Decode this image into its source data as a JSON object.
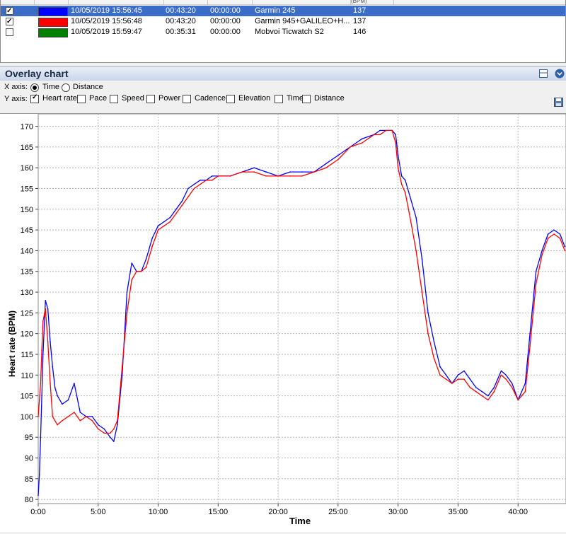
{
  "sessions": {
    "header_partial": "(BPM)",
    "rows": [
      {
        "checked": true,
        "selected": true,
        "color": "#0000ff",
        "start": "10/05/2019 15:56:45",
        "duration": "00:43:20",
        "offset": "00:00:00",
        "device": "Garmin 245",
        "hr": "137"
      },
      {
        "checked": true,
        "selected": false,
        "color": "#ff0000",
        "start": "10/05/2019 15:56:48",
        "duration": "00:43:20",
        "offset": "00:00:00",
        "device": "Garmin  945+GALILEO+H...",
        "hr": "137"
      },
      {
        "checked": false,
        "selected": false,
        "color": "#008000",
        "start": "10/05/2019 15:59:47",
        "duration": "00:35:31",
        "offset": "00:00:00",
        "device": "Mobvoi Ticwatch S2",
        "hr": "146"
      }
    ]
  },
  "panel": {
    "title": "Overlay chart",
    "xaxis_label": "X axis:",
    "xaxis_options": [
      {
        "label": "Time",
        "selected": true
      },
      {
        "label": "Distance",
        "selected": false
      }
    ],
    "yaxis_label": "Y axis:",
    "yaxis_options": [
      {
        "label": "Heart rate",
        "checked": true
      },
      {
        "label": "Pace",
        "checked": false
      },
      {
        "label": "Speed",
        "checked": false
      },
      {
        "label": "Power",
        "checked": false
      },
      {
        "label": "Cadence",
        "checked": false
      },
      {
        "label": "Elevation",
        "checked": false
      },
      {
        "label": "Time",
        "checked": false
      },
      {
        "label": "Distance",
        "checked": false
      }
    ]
  },
  "chart_data": {
    "type": "line",
    "xlabel": "Time",
    "ylabel": "Heart rate (BPM)",
    "xlim": [
      0,
      44
    ],
    "ylim": [
      79,
      173
    ],
    "x_ticks": [
      0,
      5,
      10,
      15,
      20,
      25,
      30,
      35,
      40
    ],
    "x_tick_labels": [
      "0:00",
      "5:00",
      "10:00",
      "15:00",
      "20:00",
      "25:00",
      "30:00",
      "35:00",
      "40:00"
    ],
    "y_ticks": [
      80,
      85,
      90,
      95,
      100,
      105,
      110,
      115,
      120,
      125,
      130,
      135,
      140,
      145,
      150,
      155,
      160,
      165,
      170
    ],
    "grid": true,
    "series": [
      {
        "color": "#0000ff",
        "x": [
          0,
          0.1,
          0.2,
          0.3,
          0.4,
          0.6,
          0.8,
          1.0,
          1.2,
          1.4,
          1.6,
          2.0,
          2.5,
          3.0,
          3.5,
          4.0,
          4.5,
          5.0,
          5.5,
          6.0,
          6.3,
          6.6,
          7.0,
          7.4,
          7.8,
          8.2,
          8.6,
          9.0,
          9.5,
          10.0,
          10.5,
          11.0,
          11.5,
          12.0,
          12.5,
          13.0,
          13.5,
          14.0,
          14.5,
          15.0,
          16.0,
          17.0,
          18.0,
          19.0,
          20.0,
          21.0,
          22.0,
          23.0,
          24.0,
          25.0,
          26.0,
          27.0,
          28.0,
          28.5,
          29.0,
          29.5,
          29.8,
          30.0,
          30.3,
          30.6,
          31.0,
          31.5,
          32.0,
          32.5,
          33.0,
          33.5,
          34.0,
          34.5,
          35.0,
          35.5,
          36.0,
          36.5,
          37.0,
          37.5,
          38.0,
          38.3,
          38.6,
          39.0,
          39.5,
          40.0,
          40.3,
          40.6,
          41.0,
          41.5,
          42.0,
          42.5,
          43.0,
          43.5,
          43.9
        ],
        "y": [
          81,
          86,
          95,
          105,
          115,
          128,
          126,
          118,
          112,
          107,
          105,
          103,
          104,
          108,
          101,
          100,
          100,
          98,
          97,
          95,
          94,
          98,
          110,
          130,
          137,
          135,
          135,
          138,
          143,
          146,
          147,
          148,
          150,
          152,
          155,
          156,
          157,
          157,
          158,
          158,
          158,
          159,
          160,
          159,
          158,
          159,
          159,
          159,
          161,
          163,
          165,
          167,
          168,
          169,
          169,
          169,
          168,
          163,
          158,
          157,
          153,
          148,
          138,
          125,
          118,
          112,
          110,
          108,
          110,
          111,
          109,
          107,
          106,
          105,
          107,
          109,
          111,
          110,
          108,
          104,
          106,
          108,
          120,
          135,
          140,
          144,
          145,
          144,
          141
        ]
      },
      {
        "color": "#ff0000",
        "x": [
          0,
          0.1,
          0.2,
          0.3,
          0.4,
          0.6,
          0.8,
          1.0,
          1.2,
          1.4,
          1.6,
          2.0,
          2.5,
          3.0,
          3.5,
          4.0,
          4.5,
          5.0,
          5.5,
          6.0,
          6.3,
          6.6,
          7.0,
          7.4,
          7.8,
          8.2,
          8.6,
          9.0,
          9.5,
          10.0,
          10.5,
          11.0,
          11.5,
          12.0,
          12.5,
          13.0,
          13.5,
          14.0,
          14.5,
          15.0,
          16.0,
          17.0,
          18.0,
          19.0,
          20.0,
          21.0,
          22.0,
          23.0,
          24.0,
          25.0,
          26.0,
          27.0,
          28.0,
          28.5,
          29.0,
          29.5,
          29.8,
          30.0,
          30.3,
          30.6,
          31.0,
          31.5,
          32.0,
          32.5,
          33.0,
          33.5,
          34.0,
          34.5,
          35.0,
          35.5,
          36.0,
          36.5,
          37.0,
          37.5,
          38.0,
          38.3,
          38.6,
          39.0,
          39.5,
          40.0,
          40.3,
          40.6,
          41.0,
          41.5,
          42.0,
          42.5,
          43.0,
          43.5,
          43.9
        ],
        "y": [
          100,
          104,
          108,
          116,
          123,
          126,
          118,
          108,
          100,
          99,
          98,
          99,
          100,
          101,
          99,
          100,
          99,
          97,
          96,
          96,
          97,
          99,
          112,
          125,
          133,
          135,
          135,
          136,
          141,
          145,
          146,
          147,
          149,
          151,
          153,
          155,
          156,
          157,
          157,
          158,
          158,
          159,
          159,
          158,
          158,
          158,
          158,
          159,
          160,
          162,
          165,
          166,
          168,
          168,
          169,
          169,
          166,
          160,
          156,
          154,
          148,
          140,
          130,
          120,
          114,
          110,
          109,
          108,
          109,
          109,
          107,
          106,
          105,
          104,
          106,
          108,
          110,
          109,
          107,
          104,
          105,
          106,
          117,
          132,
          139,
          143,
          144,
          143,
          140
        ]
      }
    ]
  }
}
